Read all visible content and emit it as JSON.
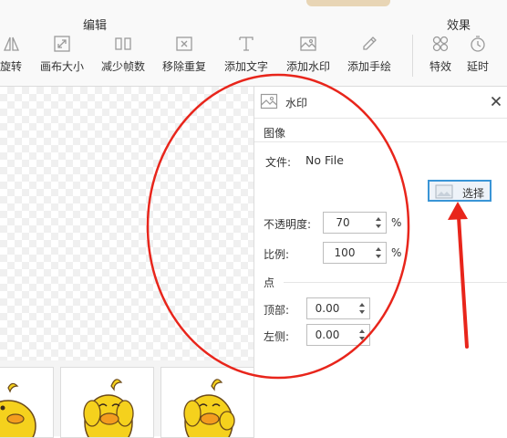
{
  "toolbar": {
    "edit_group_title": "编辑",
    "effects_group_title": "效果",
    "tools": [
      {
        "label": "旋转",
        "icon": "rotate-icon"
      },
      {
        "label": "画布大小",
        "icon": "canvas-size-icon"
      },
      {
        "label": "减少帧数",
        "icon": "reduce-frames-icon"
      },
      {
        "label": "移除重复",
        "icon": "remove-duplicates-icon"
      },
      {
        "label": "添加文字",
        "icon": "add-text-icon"
      },
      {
        "label": "添加水印",
        "icon": "add-watermark-icon"
      },
      {
        "label": "添加手绘",
        "icon": "add-drawing-icon"
      },
      {
        "label": "特效",
        "icon": "effects-icon"
      },
      {
        "label": "延时",
        "icon": "delay-icon"
      }
    ]
  },
  "panel": {
    "title": "水印",
    "image_section": {
      "title": "图像",
      "file_label": "文件:",
      "file_value": "No File",
      "choose_button": "选择",
      "opacity_label": "不透明度:",
      "opacity_value": "70",
      "opacity_unit": "%",
      "scale_label": "比例:",
      "scale_value": "100",
      "scale_unit": "%"
    },
    "point_section": {
      "title": "点",
      "top_label": "顶部:",
      "top_value": "0.00",
      "left_label": "左侧:",
      "left_value": "0.00"
    }
  },
  "colors": {
    "annotation_red": "#e8251b",
    "button_border": "#3a95d6",
    "duck_yellow": "#f5d11d",
    "duck_beak": "#f39c1f"
  }
}
